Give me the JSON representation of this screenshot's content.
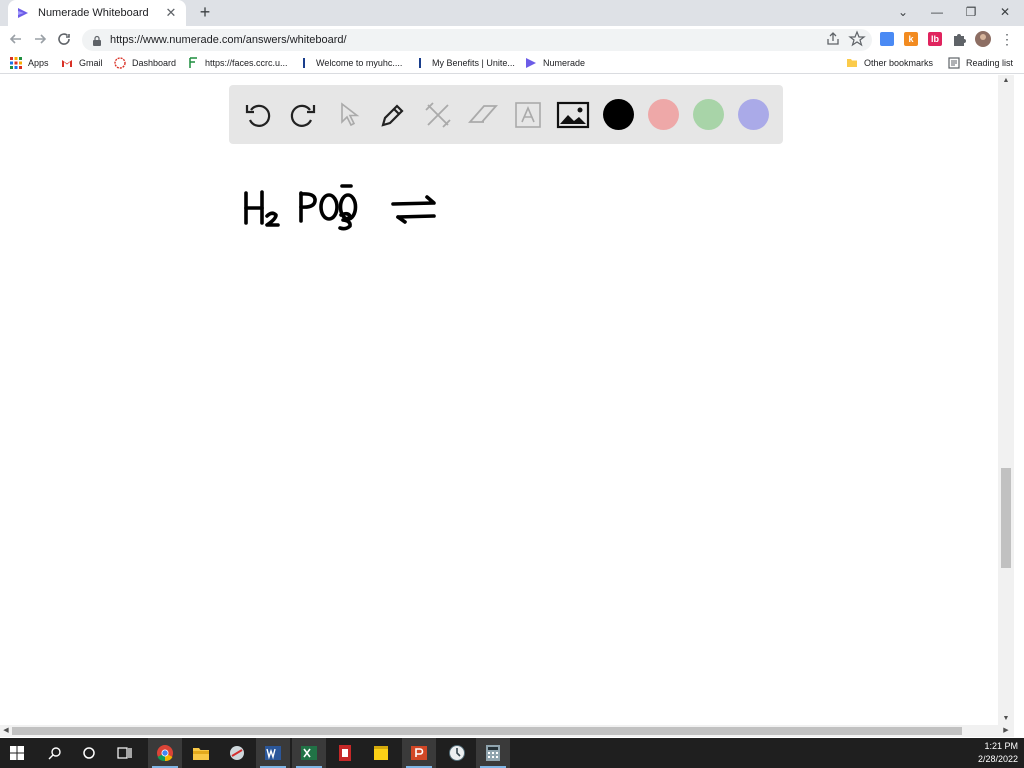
{
  "browser": {
    "tab_title": "Numerade Whiteboard",
    "tab_close": "✕",
    "new_tab": "+",
    "url": "https://www.numerade.com/answers/whiteboard/",
    "window_controls": {
      "minimize": "—",
      "restore": "❐",
      "close": "✕",
      "menu": "⌄"
    }
  },
  "bookmarks": [
    {
      "label": "Apps",
      "icon": "apps-grid-icon"
    },
    {
      "label": "Gmail",
      "icon": "gmail-icon"
    },
    {
      "label": "Dashboard",
      "icon": "dashboard-icon"
    },
    {
      "label": "https://faces.ccrc.u...",
      "icon": "faces-icon"
    },
    {
      "label": "Welcome to myuhc....",
      "icon": "uhc-icon"
    },
    {
      "label": "My Benefits | Unite...",
      "icon": "benefits-icon"
    },
    {
      "label": "Numerade",
      "icon": "numerade-icon"
    }
  ],
  "bookmarks_right": [
    {
      "label": "Other bookmarks",
      "icon": "folder-icon"
    },
    {
      "label": "Reading list",
      "icon": "reading-list-icon"
    }
  ],
  "whiteboard": {
    "tools": [
      "undo-icon",
      "redo-icon",
      "select-icon",
      "pen-icon",
      "tools-icon",
      "eraser-icon",
      "text-icon",
      "image-icon"
    ],
    "colors": [
      "#000000",
      "#eea8a8",
      "#a8d4a8",
      "#aaaae8"
    ],
    "handwriting": "H2PO3- ⇌"
  },
  "taskbar": {
    "time": "1:21 PM",
    "date": "2/28/2022"
  }
}
